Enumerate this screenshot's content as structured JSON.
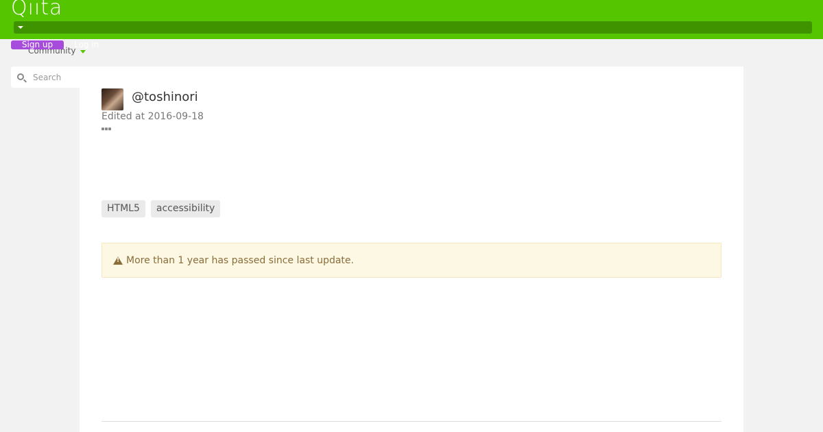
{
  "header": {
    "logo": "Qiita",
    "signup_label": "Sign up",
    "login_label": "Log in",
    "community_label": "Community",
    "brand_color": "#55c500"
  },
  "search": {
    "placeholder": "Search"
  },
  "article": {
    "author": "@toshinori",
    "edited": "Edited at 2016-09-18",
    "tags": [
      "HTML5",
      "accessibility"
    ],
    "alert": "More than 1 year has passed since last update."
  }
}
